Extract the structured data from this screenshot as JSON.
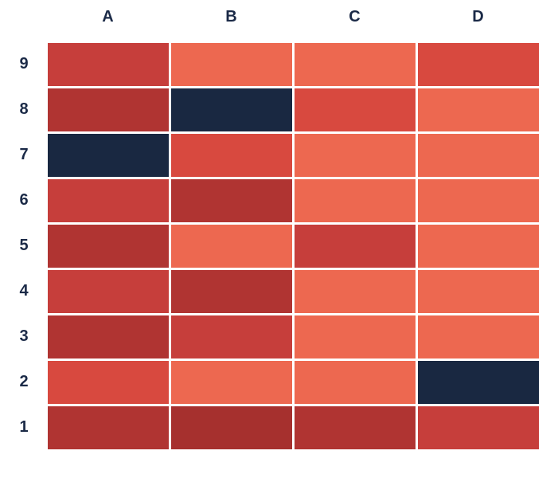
{
  "chart_data": {
    "type": "heatmap",
    "title": "",
    "xlabel": "",
    "ylabel": "",
    "columns": [
      "A",
      "B",
      "C",
      "D"
    ],
    "rows": [
      "9",
      "8",
      "7",
      "6",
      "5",
      "4",
      "3",
      "2",
      "1"
    ],
    "palette_note": "0 = dark navy outlier, 1 = darkest red, 5 = lightest coral",
    "palette": {
      "0": "#192841",
      "1": "#a6302e",
      "2": "#b03432",
      "3": "#c63e3b",
      "4": "#d8493f",
      "5": "#ed6850"
    },
    "values": [
      [
        3,
        5,
        5,
        4
      ],
      [
        2,
        0,
        4,
        5
      ],
      [
        0,
        4,
        5,
        5
      ],
      [
        3,
        2,
        5,
        5
      ],
      [
        2,
        5,
        3,
        5
      ],
      [
        3,
        2,
        5,
        5
      ],
      [
        2,
        3,
        5,
        5
      ],
      [
        4,
        5,
        5,
        0
      ],
      [
        2,
        1,
        2,
        3
      ]
    ]
  }
}
